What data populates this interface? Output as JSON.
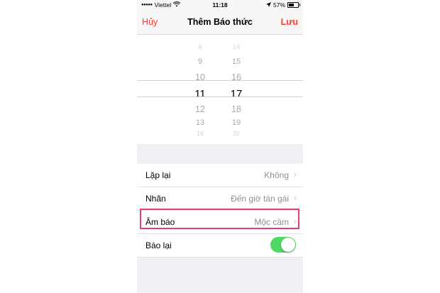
{
  "status_bar": {
    "signal_dots": "●●●●●",
    "carrier": "Viettel",
    "time": "11:18",
    "battery": "57%",
    "battery_level": 0.57
  },
  "nav": {
    "cancel_label": "Hủy",
    "title": "Thêm Báo thức",
    "save_label": "Lưu"
  },
  "picker": {
    "hours": [
      "8",
      "9",
      "10",
      "11",
      "12",
      "13",
      "14"
    ],
    "minutes": [
      "14",
      "15",
      "16",
      "17",
      "18",
      "19",
      "20"
    ],
    "selected_hour": "11",
    "selected_minute": "17"
  },
  "settings": {
    "repeat": {
      "label": "Lặp lại",
      "value": "Không"
    },
    "label": {
      "label": "Nhãn",
      "value": "Đến giờ tán gái"
    },
    "sound": {
      "label": "Âm báo",
      "value": "Mộc cầm"
    },
    "snooze": {
      "label": "Báo lại",
      "on": true
    }
  },
  "colors": {
    "accent": "#ff3b30",
    "toggle_on": "#4cd964",
    "highlight_box": "#e23d7f"
  }
}
